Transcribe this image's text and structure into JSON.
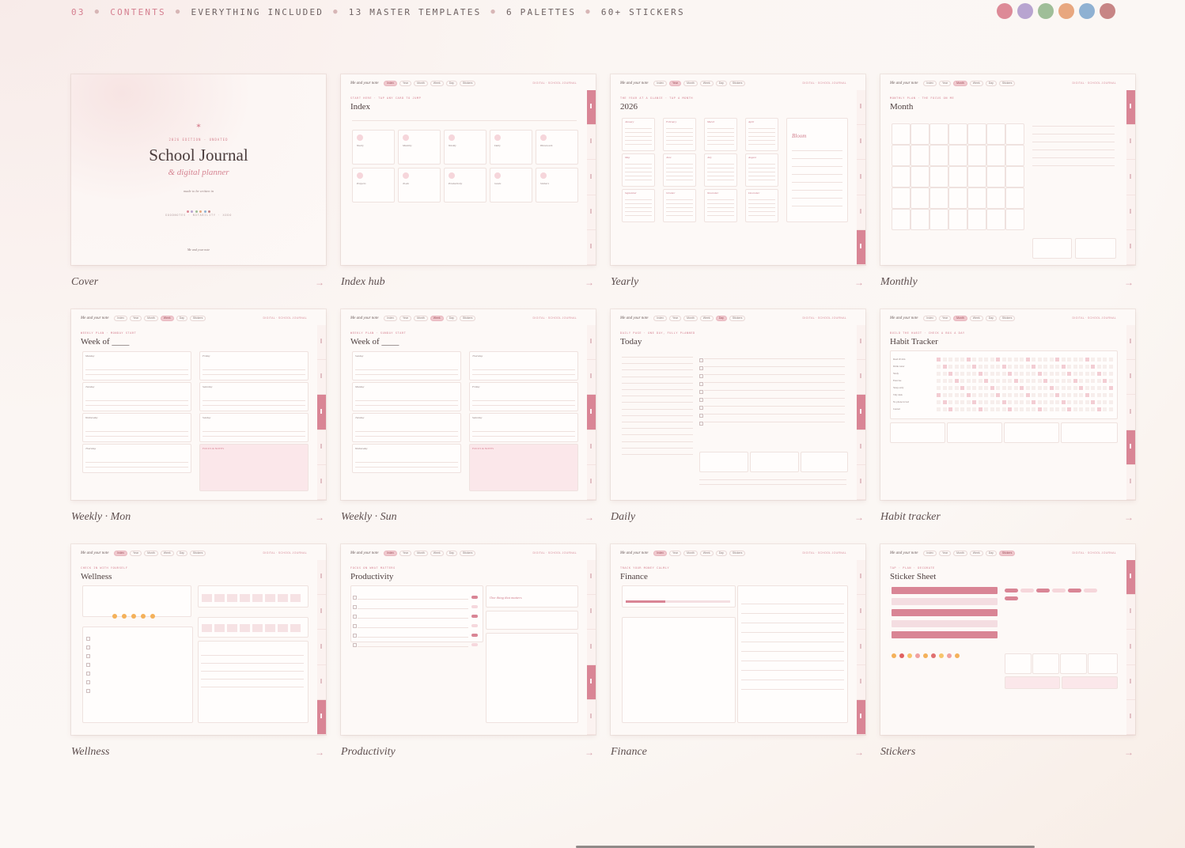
{
  "header": {
    "section_number": "03",
    "section_label": "CONTENTS",
    "items": [
      "EVERYTHING INCLUDED",
      "13 MASTER TEMPLATES",
      "6 PALETTES",
      "60+ STICKERS"
    ],
    "palette_swatches": [
      "#dd8a97",
      "#b8a4d0",
      "#9fbe98",
      "#e8a77f",
      "#8fb1d2",
      "#c78585"
    ]
  },
  "nav_brand": "Me and your note",
  "nav_tabs": [
    "Index",
    "Year",
    "Month",
    "Week",
    "Day",
    "Stickers"
  ],
  "nav_util": "DIGITAL · SCHOOL JOURNAL",
  "side_tabs": [
    "Homework",
    "Projects",
    "To-do",
    "Productivity",
    "Goals"
  ],
  "cover": {
    "eyebrow": "2026 EDITION · UNDATED",
    "title": "School Journal",
    "subtitle": "& digital planner",
    "tagline": "made to be written in",
    "footer_small": "GOODNOTES · NOTABILITY · XODO",
    "brand": "Me and your note"
  },
  "templates": [
    {
      "caption": "Cover",
      "eyebrow": "",
      "title": ""
    },
    {
      "caption": "Index hub",
      "eyebrow": "START HERE · TAP ANY CARD TO JUMP",
      "title": "Index",
      "cards": [
        "Yearly",
        "Monthly",
        "Weekly",
        "Daily",
        "Homework",
        "Projects",
        "To-do",
        "Productivity",
        "Goals",
        "Stickers"
      ]
    },
    {
      "caption": "Yearly",
      "eyebrow": "THE YEAR AT A GLANCE · TAP A MONTH",
      "title": "2026",
      "months": [
        "January",
        "February",
        "March",
        "April",
        "May",
        "June",
        "July",
        "August",
        "September",
        "October",
        "November",
        "December"
      ],
      "side": "Bloom"
    },
    {
      "caption": "Monthly",
      "eyebrow": "MONTHLY PLAN · THE FOCUS ON ME",
      "title": "Month"
    },
    {
      "caption": "Weekly · Mon",
      "eyebrow": "WEEKLY PLAN · MONDAY START",
      "title": "Week of ____",
      "days": [
        "Monday",
        "Friday",
        "Tuesday",
        "Saturday",
        "Wednesday",
        "Sunday",
        "Thursday",
        "FOCUS & NOTES"
      ]
    },
    {
      "caption": "Weekly · Sun",
      "eyebrow": "WEEKLY PLAN · SUNDAY START",
      "title": "Week of ____",
      "days": [
        "Sunday",
        "Thursday",
        "Monday",
        "Friday",
        "Tuesday",
        "Saturday",
        "Wednesday",
        "FOCUS & NOTES"
      ]
    },
    {
      "caption": "Daily",
      "eyebrow": "DAILY PAGE · ONE DAY, FULLY PLANNED",
      "title": "Today"
    },
    {
      "caption": "Habit tracker",
      "eyebrow": "BUILD THE HABIT · CHECK A BOX A DAY",
      "title": "Habit Tracker",
      "habits": [
        "Read 20 min",
        "Drink water",
        "Study",
        "Exercise",
        "Sleep early",
        "Tidy desk",
        "No phone in bed",
        "Journal"
      ]
    },
    {
      "caption": "Wellness",
      "eyebrow": "CHECK IN WITH YOURSELF",
      "title": "Wellness"
    },
    {
      "caption": "Productivity",
      "eyebrow": "FOCUS ON WHAT MATTERS",
      "title": "Productivity",
      "focus": "One thing that matters"
    },
    {
      "caption": "Finance",
      "eyebrow": "TRACK YOUR MONEY CALMLY",
      "title": "Finance"
    },
    {
      "caption": "Stickers",
      "eyebrow": "TAP · PLAN · DECORATE",
      "title": "Sticker Sheet"
    }
  ]
}
